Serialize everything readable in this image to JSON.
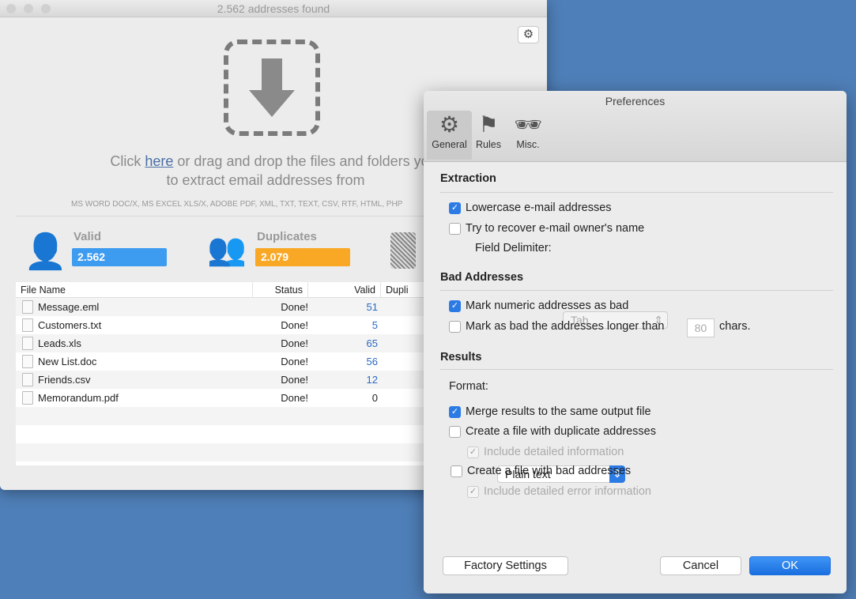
{
  "main": {
    "title": "2.562 addresses found",
    "instr_pre": "Click ",
    "instr_link": "here",
    "instr_post": " or drag and drop the files and folders you",
    "instr_line2": "to extract email addresses from",
    "formats": "MS WORD DOC/X, MS EXCEL XLS/X, ADOBE PDF, XML, TXT, TEXT, CSV, RTF, HTML, PHP",
    "stats": [
      {
        "label": "Valid",
        "value": "2.562",
        "color": "#3d9bf0"
      },
      {
        "label": "Duplicates",
        "value": "2.079",
        "color": "#f9a825"
      }
    ],
    "columns": [
      "File Name",
      "Status",
      "Valid",
      "Dupli"
    ],
    "rows": [
      {
        "name": "Message.eml",
        "status": "Done!",
        "valid": "51"
      },
      {
        "name": "Customers.txt",
        "status": "Done!",
        "valid": "5"
      },
      {
        "name": "Leads.xls",
        "status": "Done!",
        "valid": "65"
      },
      {
        "name": "New List.doc",
        "status": "Done!",
        "valid": "56"
      },
      {
        "name": "Friends.csv",
        "status": "Done!",
        "valid": "12"
      },
      {
        "name": "Memorandum.pdf",
        "status": "Done!",
        "valid": "0"
      }
    ]
  },
  "prefs": {
    "title": "Preferences",
    "tabs": [
      "General",
      "Rules",
      "Misc."
    ],
    "extraction": "Extraction",
    "lowercase": "Lowercase e-mail addresses",
    "recover": "Try to recover e-mail owner's name",
    "delim_label": "Field Delimiter:",
    "delim_value": "Tab",
    "bad": "Bad Addresses",
    "numeric": "Mark numeric addresses as bad",
    "longer": "Mark as bad the addresses longer than",
    "longer_value": "80",
    "chars": "chars.",
    "results": "Results",
    "format_label": "Format:",
    "format_value": "Plain text",
    "merge": "Merge results to the same output file",
    "dup_file": "Create a file with duplicate addresses",
    "dup_detail": "Include detailed information",
    "bad_file": "Create a file with bad addresses",
    "bad_detail": "Include detailed error information",
    "factory": "Factory Settings",
    "cancel": "Cancel",
    "ok": "OK"
  }
}
